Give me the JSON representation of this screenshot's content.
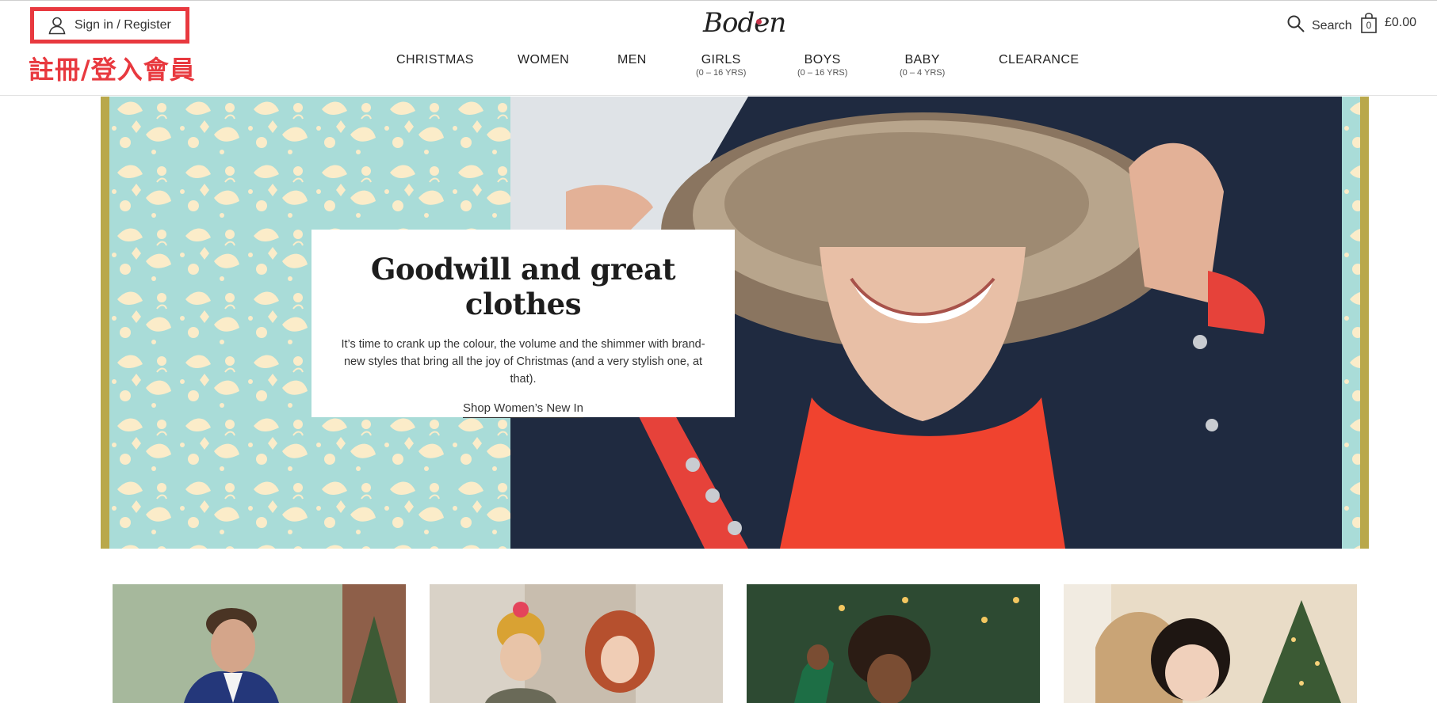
{
  "header": {
    "signin_label": "Sign in / Register",
    "annotation": "註冊/登入會員",
    "logo_text": "Boden",
    "search_label": "Search",
    "bag_count": "0",
    "bag_total": "£0.00"
  },
  "nav": {
    "items": [
      {
        "label": "CHRISTMAS",
        "sub": ""
      },
      {
        "label": "WOMEN",
        "sub": ""
      },
      {
        "label": "MEN",
        "sub": ""
      },
      {
        "label": "GIRLS",
        "sub": "(0 – 16 YRS)"
      },
      {
        "label": "BOYS",
        "sub": "(0 – 16 YRS)"
      },
      {
        "label": "BABY",
        "sub": "(0 – 4 YRS)"
      },
      {
        "label": "CLEARANCE",
        "sub": ""
      }
    ]
  },
  "hero": {
    "title": "Goodwill and great clothes",
    "body": "It’s time to crank up the colour, the volume and the shimmer with brand-new styles that bring all the joy of Christmas (and a very stylish one, at that).",
    "cta": "Shop Women’s New In"
  },
  "colors": {
    "accent_red": "#e8393f",
    "pattern_teal": "#a9dcd8",
    "pattern_cream": "#fbecc9",
    "gold_edge": "#b9a84b"
  },
  "icons": [
    "user-icon",
    "search-icon",
    "bag-icon"
  ]
}
